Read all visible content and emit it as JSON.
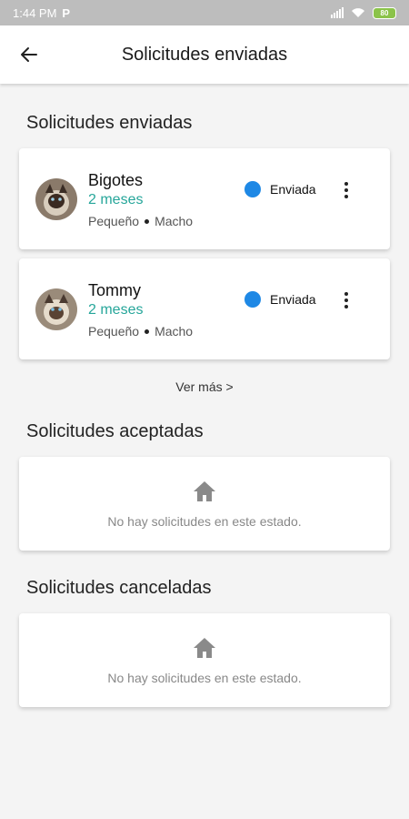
{
  "status_bar": {
    "time": "1:44 PM",
    "extra": "P",
    "battery": "80"
  },
  "header": {
    "title": "Solicitudes enviadas",
    "back_icon": "arrow-left-icon"
  },
  "sections": {
    "sent": {
      "title": "Solicitudes enviadas",
      "items": [
        {
          "name": "Bigotes",
          "age": "2 meses",
          "size": "Pequeño",
          "sex": "Macho",
          "status": "Enviada"
        },
        {
          "name": "Tommy",
          "age": "2 meses",
          "size": "Pequeño",
          "sex": "Macho",
          "status": "Enviada"
        }
      ],
      "see_more": "Ver más >"
    },
    "accepted": {
      "title": "Solicitudes aceptadas",
      "empty_text": "No hay solicitudes en este estado."
    },
    "cancelled": {
      "title": "Solicitudes canceladas",
      "empty_text": "No hay solicitudes en este estado."
    }
  },
  "colors": {
    "accent_teal": "#26a69a",
    "status_blue": "#1e88e5",
    "empty_icon": "#8a8a8a"
  }
}
